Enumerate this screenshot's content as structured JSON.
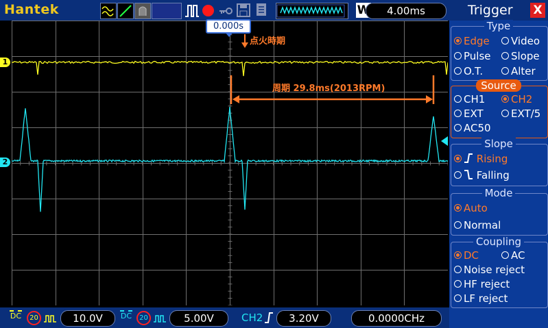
{
  "toolbar": {
    "brand": "Hantek",
    "timebase": "4.00ms",
    "icons": [
      "sine-wave-icon",
      "ramp-icon",
      "persist-icon",
      "pulse-icon",
      "record-icon",
      "key-icon",
      "save-icon",
      "print-icon",
      "memory-depth-icon",
      "window-icon"
    ],
    "record_color": "#ff1a1a"
  },
  "plot": {
    "trigger_position": "0.000s",
    "annotation_ignition": "点火時期",
    "annotation_period": "周期 29.8ms(2013RPM)",
    "ch1_marker": "1",
    "ch2_marker": "2",
    "colors": {
      "ch1": "#ffff22",
      "ch2": "#22e6f2",
      "annotation": "#ff7a2a",
      "grid": "#707070"
    }
  },
  "trigger": {
    "title": "Trigger",
    "close_label": "X",
    "type": {
      "heading": "Type",
      "options": [
        "Edge",
        "Video",
        "Pulse",
        "Slope",
        "O.T.",
        "Alter"
      ],
      "selected": "Edge"
    },
    "source": {
      "heading": "Source",
      "options": [
        "CH1",
        "CH2",
        "EXT",
        "EXT/5",
        "AC50"
      ],
      "selected": "CH2"
    },
    "slope": {
      "heading": "Slope",
      "options": [
        "Rising",
        "Falling"
      ],
      "selected": "Rising"
    },
    "mode": {
      "heading": "Mode",
      "options": [
        "Auto",
        "Normal"
      ],
      "selected": "Auto"
    },
    "coupling": {
      "heading": "Coupling",
      "options": [
        "DC",
        "AC",
        "Noise reject",
        "HF reject",
        "LF reject"
      ],
      "selected": "DC"
    }
  },
  "status": {
    "ch1": {
      "coupling": "DC",
      "bw": "20",
      "volts": "10.0V"
    },
    "ch2": {
      "coupling": "DC",
      "bw": "20",
      "volts": "5.00V"
    },
    "trigger_channel": "CH2",
    "trigger_level": "3.20V",
    "frequency": "0.0000CHz"
  }
}
